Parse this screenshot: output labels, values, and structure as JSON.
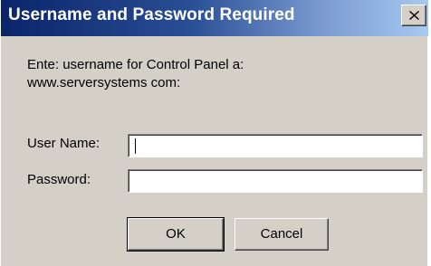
{
  "dialog": {
    "title": "Username and Password Required",
    "close_glyph": "✕",
    "prompt_line1": "Ente: username for Control Panel a:",
    "prompt_line2": "www.serversystems com:",
    "username_label": "User Name:",
    "username_value": "",
    "password_label": "Password:",
    "password_value": "",
    "ok_label": "OK",
    "cancel_label": "Cancel"
  },
  "colors": {
    "titlebar_start": "#0a246a",
    "titlebar_end": "#a6caf0",
    "dialog_bg": "#d4d0c8"
  },
  "icons": {
    "close": "close-icon"
  }
}
